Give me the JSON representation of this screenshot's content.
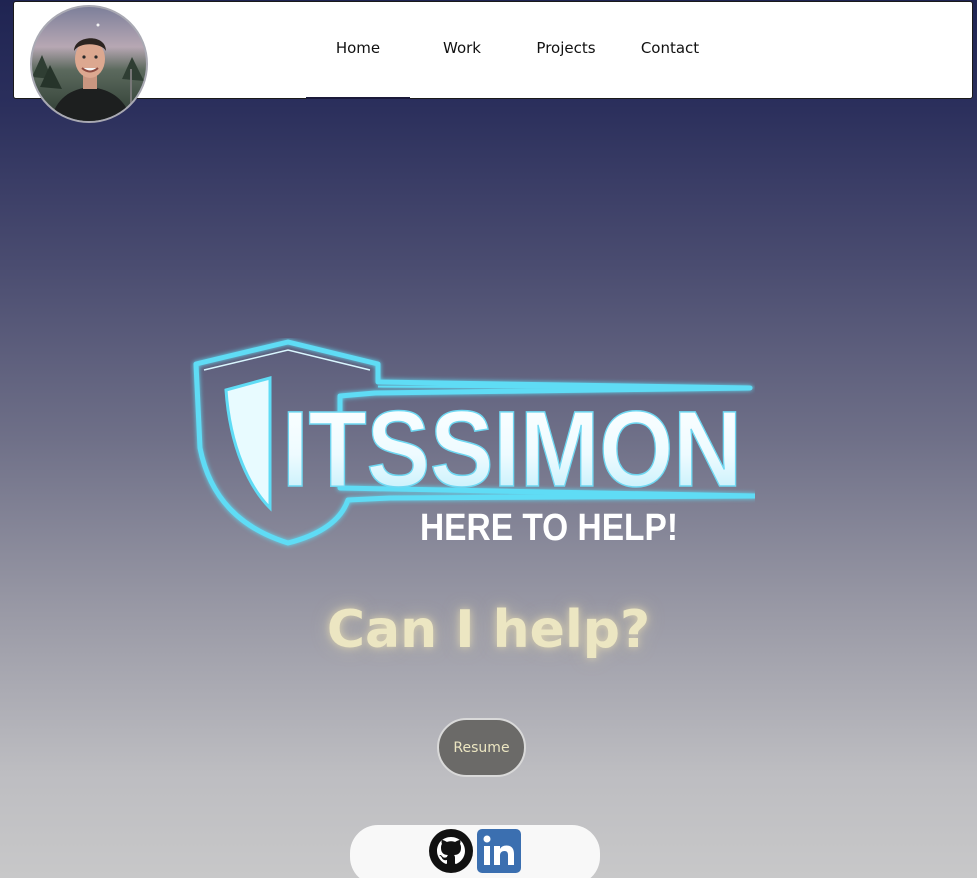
{
  "nav": {
    "items": [
      {
        "label": "Home",
        "active": true
      },
      {
        "label": "Work",
        "active": false
      },
      {
        "label": "Projects",
        "active": false
      },
      {
        "label": "Contact",
        "active": false
      }
    ]
  },
  "hero": {
    "logo_text": "ITSSIMON",
    "logo_subtitle": "HERE TO HELP!",
    "tagline": "Can I help?",
    "resume_label": "Resume"
  },
  "social": {
    "icons": [
      "github-icon",
      "linkedin-icon"
    ]
  },
  "colors": {
    "tagline": "#ece6c2",
    "logo_cyan": "#5fdcf5",
    "linkedin_blue": "#3b6fb0"
  }
}
